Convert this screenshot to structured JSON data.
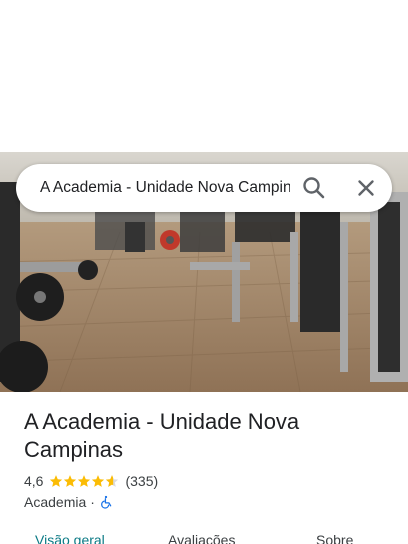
{
  "search": {
    "query": "A Academia - Unidade Nova Campinas"
  },
  "place": {
    "title": "A Academia - Unidade Nova Campinas",
    "rating": "4,6",
    "review_count": "(335)",
    "rating_value": 4.6,
    "category": "Academia",
    "separator": "·"
  },
  "tabs": [
    {
      "label": "Visão geral"
    },
    {
      "label": "Avaliações"
    },
    {
      "label": "Sobre"
    }
  ],
  "colors": {
    "accent": "#0b7a85",
    "star": "#fbbc04",
    "accessibility": "#1a73e8",
    "text": "#202124"
  },
  "icons": {
    "search": "search-icon",
    "close": "close-icon",
    "accessibility": "wheelchair-icon",
    "star": "star-icon"
  }
}
